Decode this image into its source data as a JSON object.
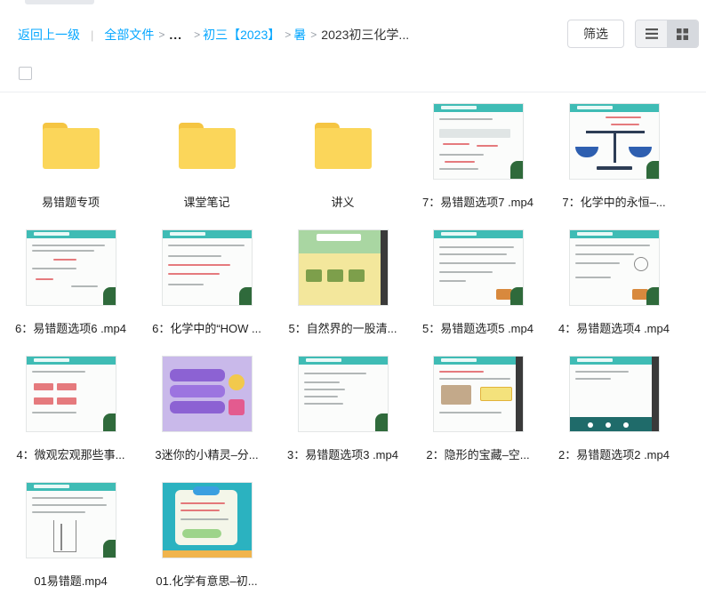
{
  "breadcrumb": {
    "back": "返回上一级",
    "separator": "|",
    "root": "全部文件",
    "ellipsis": "...",
    "level1": "初三【2023】",
    "level2": "暑",
    "current": "2023初三化学..."
  },
  "toolbar": {
    "filter_label": "筛选",
    "view_modes": [
      "list",
      "grid"
    ],
    "active_view": "grid"
  },
  "colors": {
    "accent": "#06a7ff",
    "folder": "#fbd65a",
    "slide_header": "#3fbcb5"
  },
  "files": [
    {
      "name": "易错题专项",
      "type": "folder",
      "icon": "folder-icon"
    },
    {
      "name": "课堂笔记",
      "type": "folder",
      "icon": "folder-icon"
    },
    {
      "name": "讲义",
      "type": "folder",
      "icon": "folder-icon"
    },
    {
      "name": "7：易错题选项7 .mp4",
      "type": "video",
      "icon": "video-thumbnail"
    },
    {
      "name": "7：化学中的永恒–...",
      "type": "video",
      "icon": "video-thumbnail"
    },
    {
      "name": "6：易错题选项6 .mp4",
      "type": "video",
      "icon": "video-thumbnail"
    },
    {
      "name": "6：化学中的“HOW ...",
      "type": "video",
      "icon": "video-thumbnail"
    },
    {
      "name": "5：自然界的一股清...",
      "type": "video",
      "icon": "video-thumbnail"
    },
    {
      "name": "5：易错题选项5 .mp4",
      "type": "video",
      "icon": "video-thumbnail"
    },
    {
      "name": "4：易错题选项4 .mp4",
      "type": "video",
      "icon": "video-thumbnail"
    },
    {
      "name": "4：微观宏观那些事...",
      "type": "video",
      "icon": "video-thumbnail"
    },
    {
      "name": "3迷你的小精灵–分...",
      "type": "video",
      "icon": "video-thumbnail"
    },
    {
      "name": "3：易错题选项3 .mp4",
      "type": "video",
      "icon": "video-thumbnail"
    },
    {
      "name": "2：隐形的宝藏–空...",
      "type": "video",
      "icon": "video-thumbnail"
    },
    {
      "name": "2：易错题选项2 .mp4",
      "type": "video",
      "icon": "video-thumbnail"
    },
    {
      "name": "01易错题.mp4",
      "type": "video",
      "icon": "video-thumbnail"
    },
    {
      "name": "01.化学有意思–初...",
      "type": "video",
      "icon": "video-thumbnail"
    }
  ]
}
